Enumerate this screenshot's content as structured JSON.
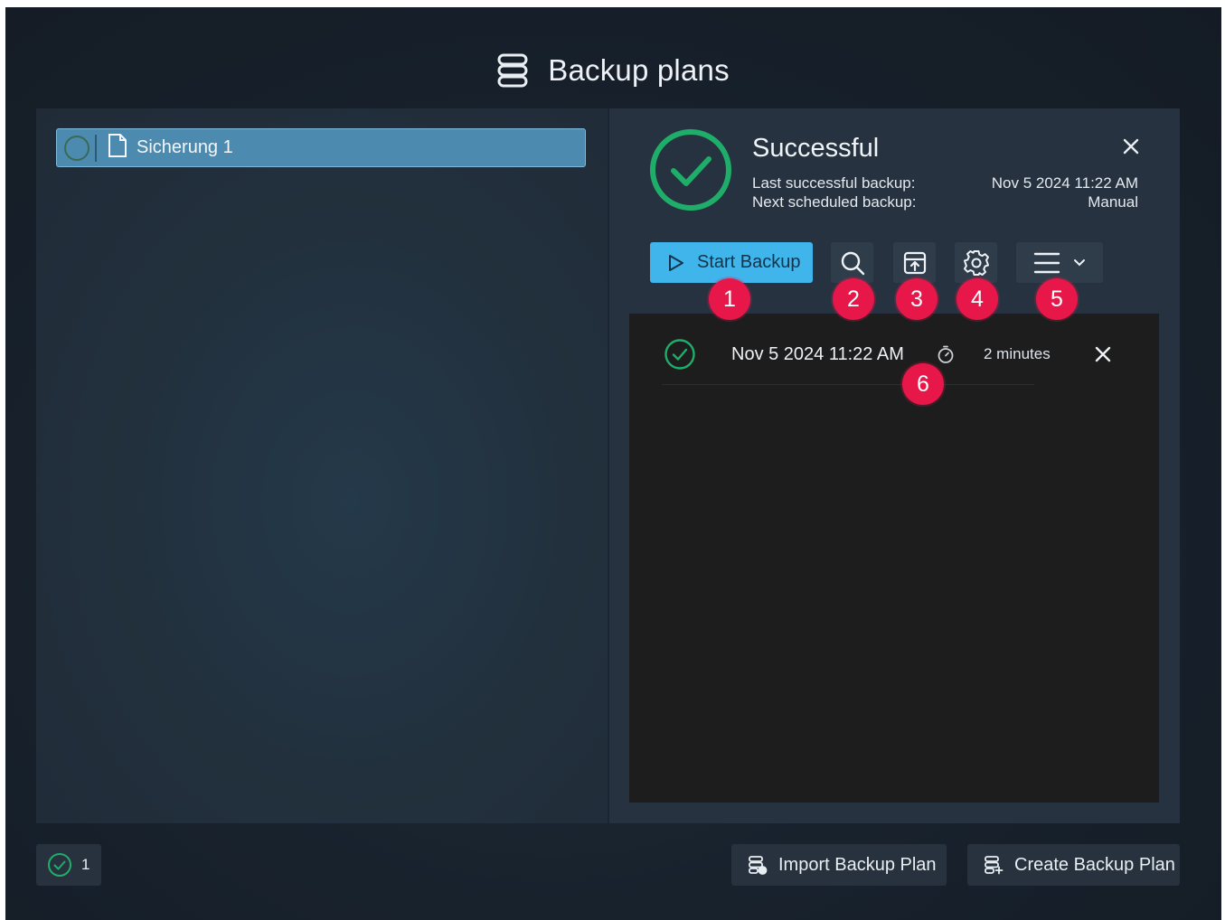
{
  "window": {
    "title": "Backup plans",
    "title_icon": "database-icon"
  },
  "plans": [
    {
      "label": "Sicherung 1",
      "icon": "document-icon",
      "selected": true
    }
  ],
  "status": {
    "title": "Successful",
    "icon": "check-circle-icon",
    "color": "#1fae6a",
    "last_backup_label": "Last successful backup:",
    "last_backup_value": "Nov 5  2024  11:22 AM",
    "next_backup_label": "Next scheduled backup:",
    "next_backup_value": "Manual"
  },
  "toolbar": {
    "start_label": "Start Backup",
    "start_icon": "play-icon",
    "accent": "#3fb5ec",
    "tools": [
      "search-icon",
      "archive-upload-icon",
      "gear-icon",
      "hamburger-menu-icon"
    ]
  },
  "badges": [
    "1",
    "2",
    "3",
    "4",
    "5",
    "6"
  ],
  "badge_color": "#e8174a",
  "history": [
    {
      "date": "Nov 5  2024  11:22 AM",
      "duration": "2 minutes",
      "status": "success"
    }
  ],
  "footer": {
    "success_count": "1",
    "import_label": "Import Backup Plan",
    "create_label": "Create Backup Plan"
  }
}
